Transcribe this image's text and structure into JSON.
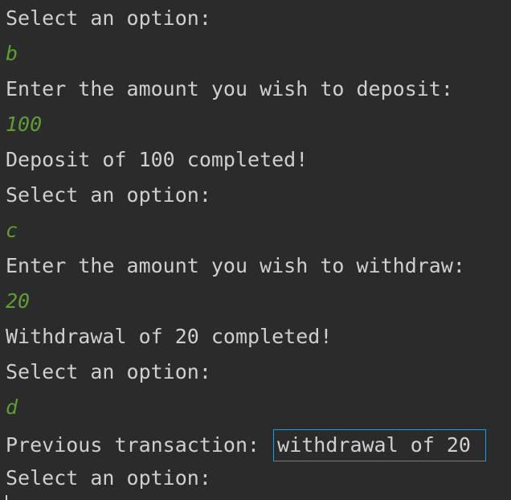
{
  "console": {
    "lines": [
      {
        "type": "output",
        "text": "Select an option:"
      },
      {
        "type": "input",
        "text": "b"
      },
      {
        "type": "output",
        "text": "Enter the amount you wish to deposit:"
      },
      {
        "type": "input",
        "text": "100"
      },
      {
        "type": "output",
        "text": "Deposit of 100 completed!"
      },
      {
        "type": "output",
        "text": "Select an option:"
      },
      {
        "type": "input",
        "text": "c"
      },
      {
        "type": "output",
        "text": "Enter the amount you wish to withdraw:"
      },
      {
        "type": "input",
        "text": "20"
      },
      {
        "type": "output",
        "text": "Withdrawal of 20 completed!"
      },
      {
        "type": "output",
        "text": "Select an option:"
      },
      {
        "type": "input",
        "text": "d"
      },
      {
        "type": "output",
        "text": "Previous transaction: ",
        "highlight": "withdrawal of 20"
      },
      {
        "type": "output",
        "text": "Select an option:"
      }
    ]
  },
  "colors": {
    "background": "#2b2b2b",
    "output_text": "#cfcfcf",
    "input_text": "#5f9c35",
    "highlight_border": "#3f8fb6"
  }
}
